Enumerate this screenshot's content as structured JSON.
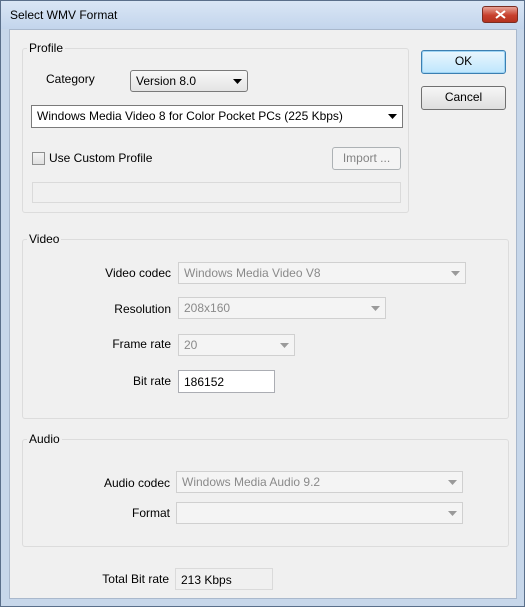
{
  "window": {
    "title": "Select WMV Format"
  },
  "profile": {
    "group_label": "Profile",
    "category_label": "Category",
    "category_value": "Version 8.0",
    "profile_value": "Windows Media Video 8 for Color Pocket PCs (225 Kbps)",
    "use_custom_label": "Use Custom Profile",
    "use_custom_checked": false,
    "import_label": "Import ...",
    "custom_path": ""
  },
  "buttons": {
    "ok": "OK",
    "cancel": "Cancel"
  },
  "video": {
    "group_label": "Video",
    "codec_label": "Video codec",
    "codec_value": "Windows Media Video V8",
    "resolution_label": "Resolution",
    "resolution_value": "208x160",
    "framerate_label": "Frame rate",
    "framerate_value": "20",
    "bitrate_label": "Bit rate",
    "bitrate_value": "186152"
  },
  "audio": {
    "group_label": "Audio",
    "codec_label": "Audio codec",
    "codec_value": "Windows Media Audio 9.2",
    "format_label": "Format",
    "format_value": ""
  },
  "total": {
    "label": "Total Bit rate",
    "value": "213 Kbps"
  },
  "icons": {
    "close": "close-icon",
    "dropdown": "chevron-down-icon"
  }
}
